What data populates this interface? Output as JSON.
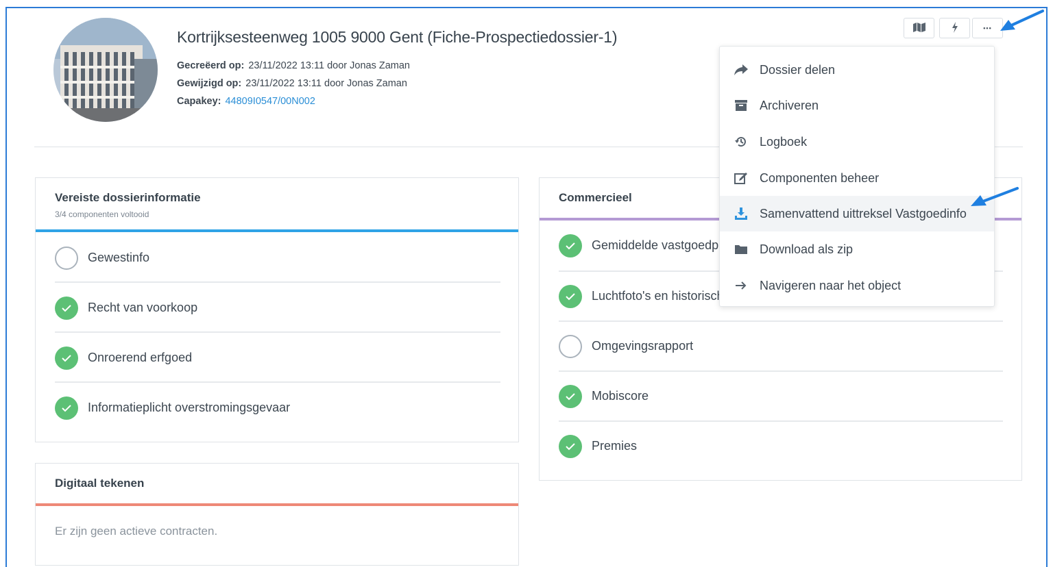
{
  "header": {
    "title": "Kortrijksesteenweg 1005 9000 Gent (Fiche-Prospectiedossier-1)",
    "created_label": "Gecreëerd op:",
    "created_value": "23/11/2022 13:11 door Jonas Zaman",
    "modified_label": "Gewijzigd op:",
    "modified_value": "23/11/2022 13:11 door Jonas Zaman",
    "capakey_label": "Capakey:",
    "capakey_value": "44809I0547/00N002"
  },
  "toolbar": {
    "map_icon": "map-icon",
    "flash_icon": "lightning-icon",
    "more_label": "•••"
  },
  "menu": {
    "items": [
      {
        "label": "Dossier delen",
        "icon": "share-icon"
      },
      {
        "label": "Archiveren",
        "icon": "archive-icon"
      },
      {
        "label": "Logboek",
        "icon": "history-icon"
      },
      {
        "label": "Componenten beheer",
        "icon": "edit-icon"
      },
      {
        "label": "Samenvattend uittreksel Vastgoedinfo",
        "icon": "download-icon",
        "highlighted": true
      },
      {
        "label": "Download als zip",
        "icon": "folder-icon"
      },
      {
        "label": "Navigeren naar het object",
        "icon": "arrow-right-icon"
      }
    ]
  },
  "required_card": {
    "title": "Vereiste dossierinformatie",
    "subtitle": "3/4 componenten voltooid",
    "accent": "#2fa3e6",
    "items": [
      {
        "label": "Gewestinfo",
        "done": false
      },
      {
        "label": "Recht van voorkoop",
        "done": true
      },
      {
        "label": "Onroerend erfgoed",
        "done": true
      },
      {
        "label": "Informatieplicht overstromingsgevaar",
        "done": true
      }
    ]
  },
  "commercial_card": {
    "title": "Commercieel",
    "accent": "#b49ad4",
    "items": [
      {
        "label": "Gemiddelde vastgoedprijzen",
        "done": true
      },
      {
        "label": "Luchtfoto's en historische kaarten",
        "done": true
      },
      {
        "label": "Omgevingsrapport",
        "done": false
      },
      {
        "label": "Mobiscore",
        "done": true
      },
      {
        "label": "Premies",
        "done": true
      }
    ]
  },
  "signing_card": {
    "title": "Digitaal tekenen",
    "accent": "#ee8877",
    "empty_text": "Er zijn geen actieve contracten."
  },
  "colors": {
    "check": "#5cc075",
    "annotation_arrow": "#1f7fe0"
  }
}
